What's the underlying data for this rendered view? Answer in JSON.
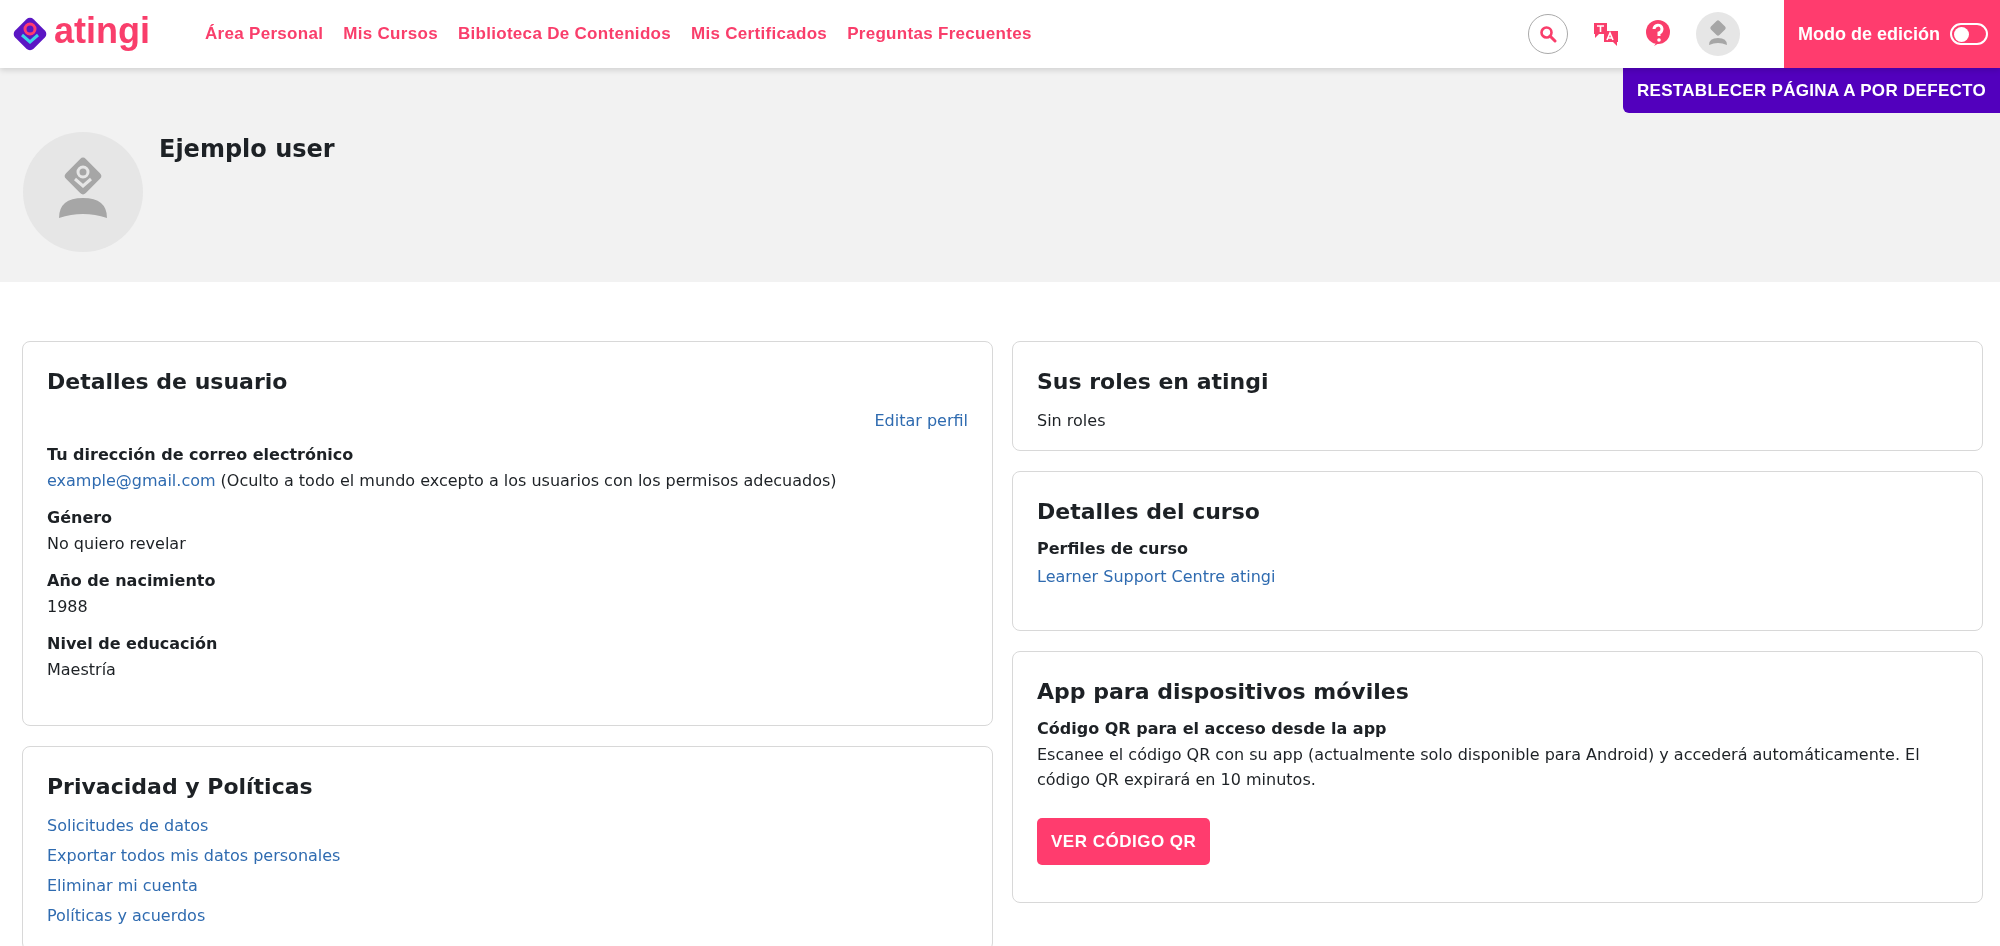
{
  "header": {
    "logo": "atingi",
    "nav": [
      {
        "label": "Área Personal"
      },
      {
        "label": "Mis Cursos"
      },
      {
        "label": "Biblioteca De Contenidos"
      },
      {
        "label": "Mis Certificados"
      },
      {
        "label": "Preguntas Frecuentes"
      }
    ],
    "edit_mode": {
      "label": "Modo de edición",
      "on": false
    }
  },
  "reset_button": "RESTABLECER PÁGINA A POR DEFECTO",
  "profile": {
    "name": "Ejemplo user"
  },
  "user_details": {
    "title": "Detalles de usuario",
    "edit_link": "Editar perfil",
    "fields": [
      {
        "label": "Tu dirección de correo electrónico",
        "kind": "link",
        "value": "example@gmail.com",
        "note": "(Oculto a todo el mundo excepto a los usuarios con los permisos adecuados)"
      },
      {
        "label": "Género",
        "kind": "text",
        "value": "No quiero revelar"
      },
      {
        "label": "Año de nacimiento",
        "kind": "text",
        "value": "1988"
      },
      {
        "label": "Nivel de educación",
        "kind": "text",
        "value": "Maestría"
      }
    ]
  },
  "privacy": {
    "title": "Privacidad y Políticas",
    "links": [
      "Solicitudes de datos",
      "Exportar todos mis datos personales",
      "Eliminar mi cuenta",
      "Políticas y acuerdos"
    ]
  },
  "roles": {
    "title": "Sus roles en atingi",
    "text": "Sin roles"
  },
  "course_details": {
    "title": "Detalles del curso",
    "subtitle": "Perfiles de curso",
    "links": [
      "Learner Support Centre atingi"
    ]
  },
  "mobile_app": {
    "title": "App para dispositivos móviles",
    "subtitle": "Código QR para el acceso desde la app",
    "text": "Escanee el código QR con su app (actualmente solo disponible para Android) y accederá automáticamente. El código QR expirará en 10 minutos.",
    "button": "VER CÓDIGO QR"
  }
}
